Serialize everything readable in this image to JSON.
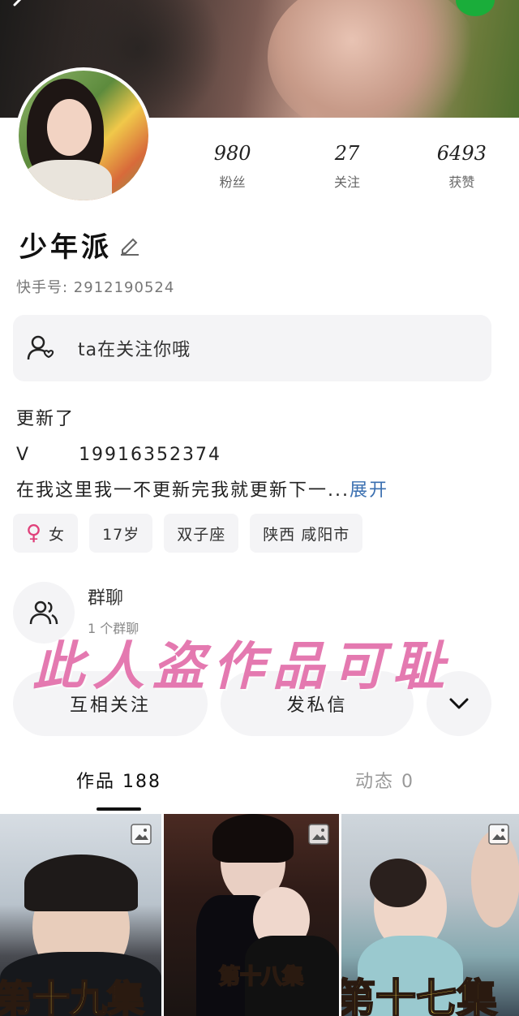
{
  "profile": {
    "name": "少年派",
    "kuaishou_id": "快手号: 2912190524",
    "stats": [
      {
        "value": "980",
        "label": "粉丝"
      },
      {
        "value": "27",
        "label": "关注"
      },
      {
        "value": "6493",
        "label": "获赞"
      }
    ],
    "follow_notice": "ta在关注你哦",
    "bio": {
      "line1": "更新了",
      "line2_prefix": "V",
      "line2_phone": "19916352374",
      "line3": "在我这里我一不更新完我就更新下一...",
      "expand": "展开"
    },
    "tags": {
      "gender_symbol": "♀",
      "gender": "女",
      "age": "17岁",
      "zodiac": "双子座",
      "location": "陕西 咸阳市"
    },
    "group_chat": {
      "title": "群聊",
      "subtitle": "1 个群聊"
    }
  },
  "watermark": "此人盗作品可耻",
  "actions": {
    "mutual": "互相关注",
    "message": "发私信"
  },
  "tabs": {
    "works": "作品 188",
    "dynamic": "动态 0"
  },
  "grid": [
    {
      "caption": "第十九集"
    },
    {
      "caption": "第十八集"
    },
    {
      "caption": "第十七集"
    }
  ],
  "colors": {
    "accent_link": "#3a6fb0",
    "watermark": "#e479b0",
    "card_bg": "#f4f4f6",
    "female_symbol": "#e0407a"
  },
  "icons": [
    "back-arrow-icon",
    "wechat-icon",
    "edit-pencil-icon",
    "user-heart-icon",
    "group-users-icon",
    "chevron-down-icon",
    "image-icon"
  ]
}
